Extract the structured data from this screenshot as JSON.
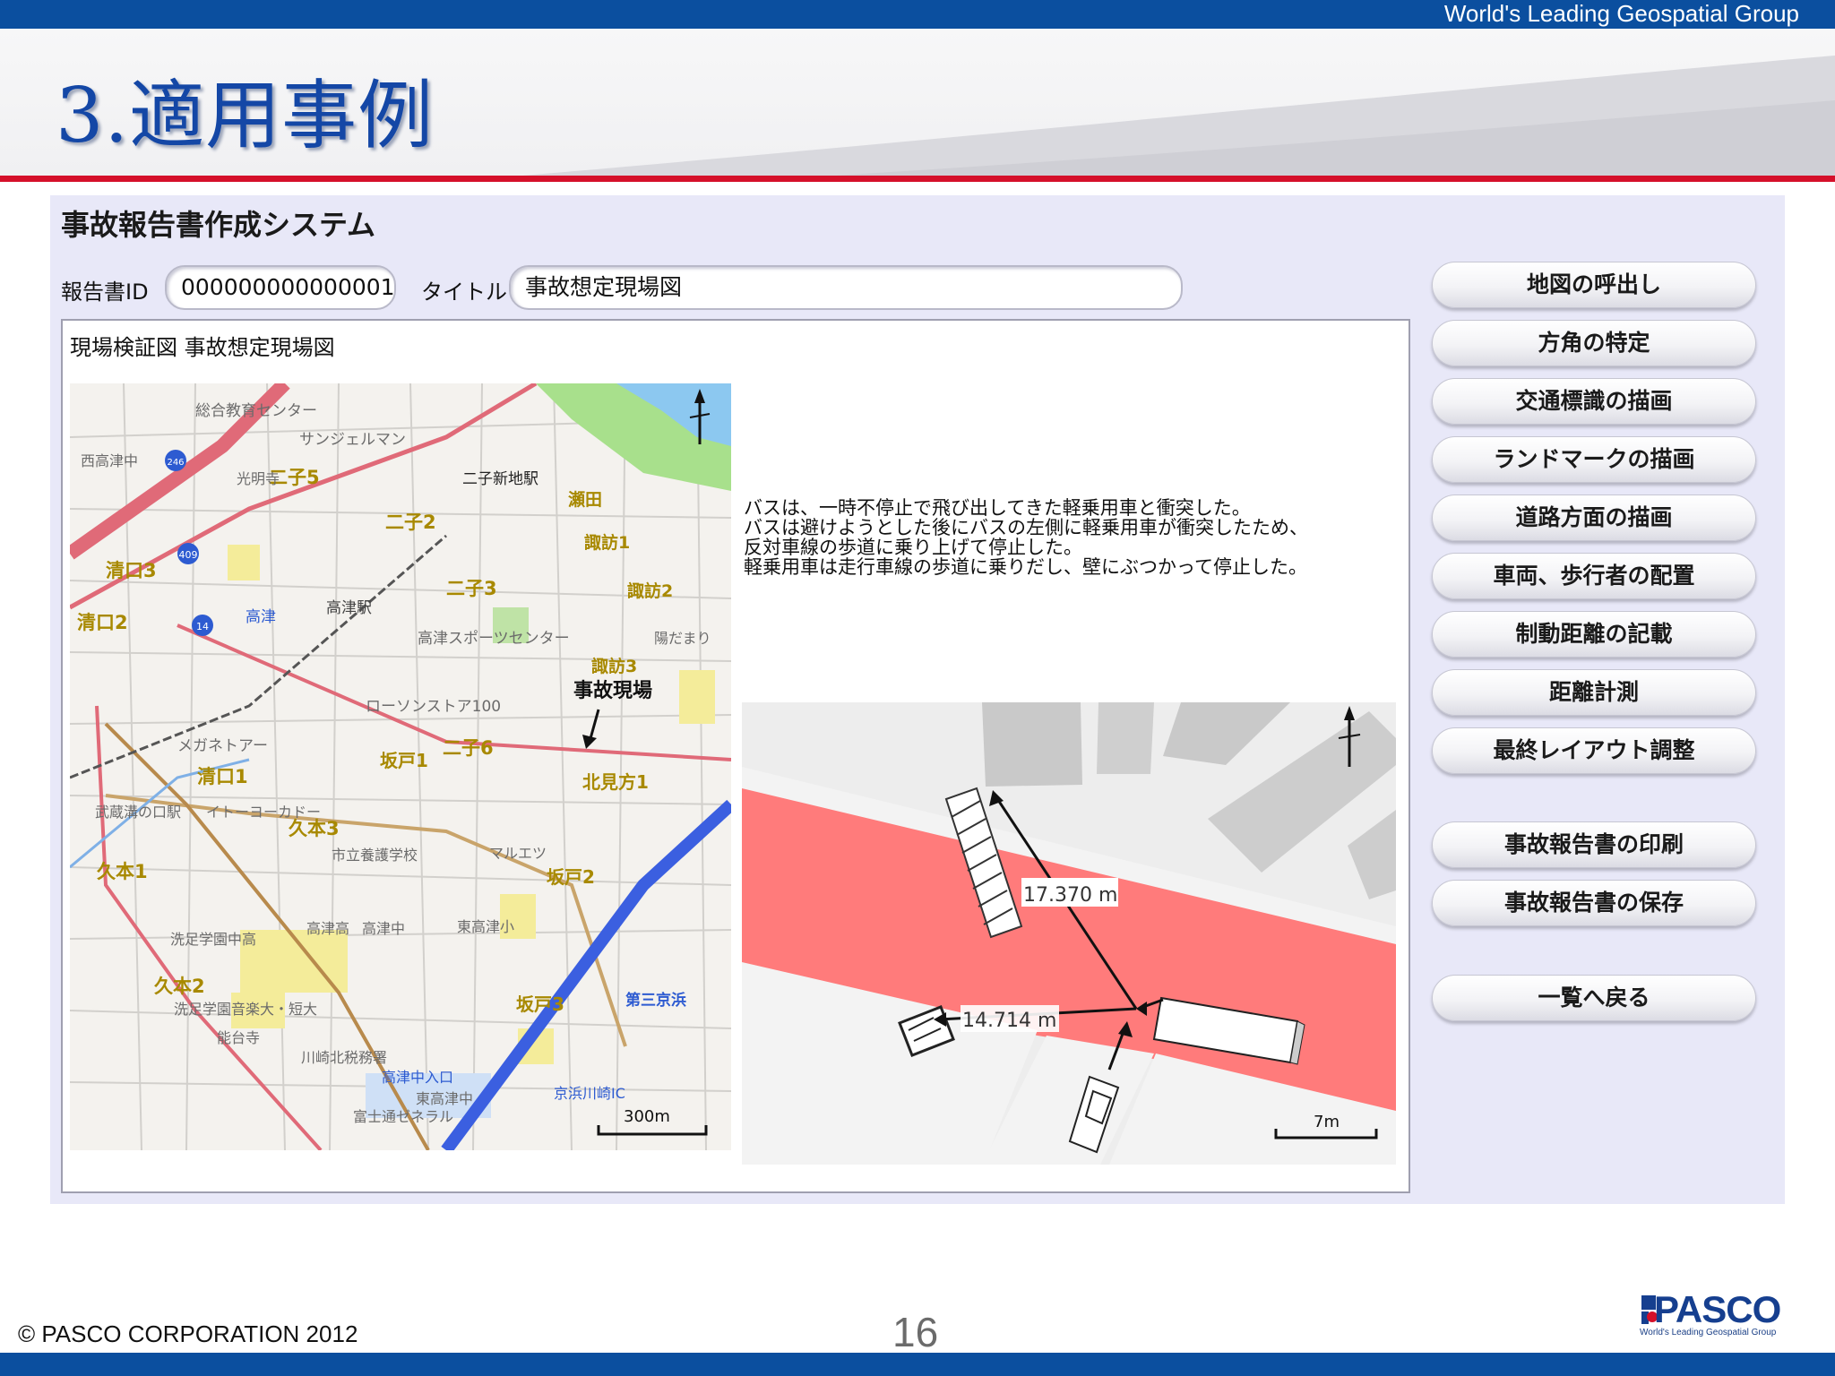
{
  "header": {
    "tagline": "World's Leading Geospatial Group",
    "slide_title": "3.適用事例"
  },
  "app": {
    "title": "事故報告書作成システム",
    "report_id_label": "報告書ID",
    "report_id_value": "000000000000001",
    "title_label": "タイトル",
    "title_value": "事故想定現場図",
    "panel_caption": "現場検証図 事故想定現場図",
    "description_lines": [
      "バスは、一時不停止で飛び出してきた軽乗用車と衝突した。",
      "バスは避けようとした後にバスの左側に軽乗用車が衝突したため、",
      "反対車線の歩道に乗り上げて停止した。",
      "軽乗用車は走行車線の歩道に乗りだし、壁にぶつかって停止した。"
    ],
    "measurements": {
      "distance_1": "17.370 m",
      "distance_2": "14.714 m",
      "scale": "7m"
    },
    "buttons": [
      "地図の呼出し",
      "方角の特定",
      "交通標識の描画",
      "ランドマークの描画",
      "道路方面の描画",
      "車両、歩行者の配置",
      "制動距離の記載",
      "距離計測",
      "最終レイアウト調整",
      "事故報告書の印刷",
      "事故報告書の保存",
      "一覧へ戻る"
    ]
  },
  "map": {
    "accident_label": "事故現場",
    "scale_label": "300m",
    "place_labels": [
      "総合教育センター",
      "サンジェルマン",
      "二子新地駅",
      "瀬田",
      "諏訪1",
      "諏訪2",
      "諏訪3",
      "二子2",
      "二子3",
      "二子5",
      "二子6",
      "清口3",
      "清口2",
      "清口1",
      "高津",
      "高津駅",
      "高津スポーツセンター",
      "ローソンストア100",
      "メガネトアー",
      "北見方1",
      "坂戸1",
      "坂戸2",
      "坂戸3",
      "久本3",
      "久本1",
      "久本2",
      "武蔵溝の口駅",
      "イトーヨーカドー",
      "市立養護学校",
      "マルエツ",
      "洗足学園中高",
      "高津高",
      "高津中",
      "洗足学園音楽大・短大",
      "能台寺",
      "川崎北税務署",
      "高津中入口",
      "富士通ゼネラル",
      "東高津中",
      "東高津小",
      "光明寺",
      "陽だまり",
      "西高津中",
      "第三京浜",
      "京浜川崎IC"
    ],
    "route_badges": [
      "409",
      "14",
      "246"
    ]
  },
  "footer": {
    "copyright": "© PASCO CORPORATION 2012",
    "page_number": "16",
    "logo_text": "PASCO",
    "logo_tagline": "World's Leading Geospatial Group"
  },
  "colors": {
    "brand_blue": "#0b4f9f",
    "accent_red": "#d5102a",
    "title_blue": "#1447a6",
    "app_background": "#e8e8f8",
    "road_red": "#ff7b7b"
  }
}
